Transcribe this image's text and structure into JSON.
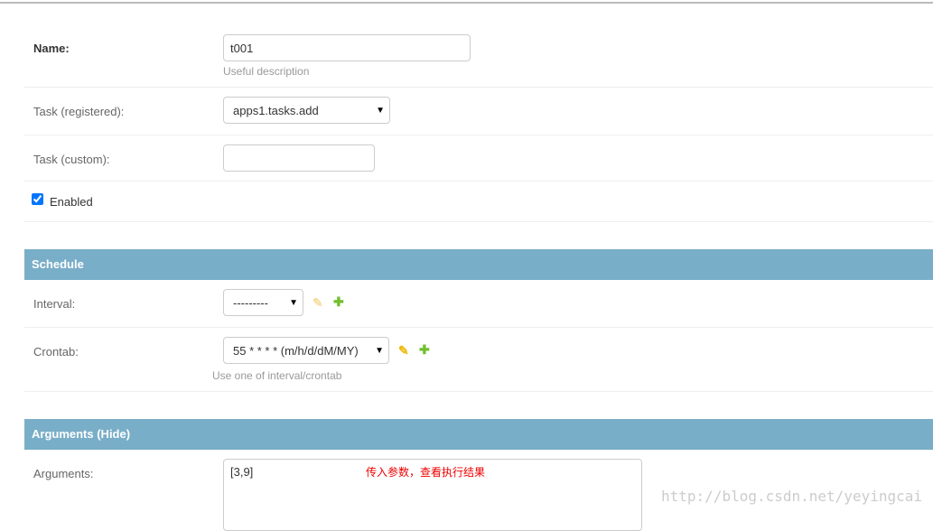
{
  "fields": {
    "name": {
      "label": "Name:",
      "value": "t001",
      "help": "Useful description"
    },
    "task_registered": {
      "label": "Task (registered):",
      "value": "apps1.tasks.add"
    },
    "task_custom": {
      "label": "Task (custom):",
      "value": ""
    },
    "enabled": {
      "label": "Enabled",
      "checked": true
    }
  },
  "schedule": {
    "title": "Schedule",
    "interval": {
      "label": "Interval:",
      "value": "---------"
    },
    "crontab": {
      "label": "Crontab:",
      "value": "55 * * * * (m/h/d/dM/MY)",
      "help": "Use one of interval/crontab"
    }
  },
  "arguments": {
    "title": "Arguments (Hide)",
    "label": "Arguments:",
    "value": "[3,9]",
    "annotation": "传入参数，查看执行结果"
  },
  "icons": {
    "edit": "pencil-icon",
    "add": "plus-icon"
  },
  "colors": {
    "header": "#79aec8",
    "add": "#70bf2b",
    "edit": "#efb80b"
  },
  "watermark": "http://blog.csdn.net/yeyingcai"
}
